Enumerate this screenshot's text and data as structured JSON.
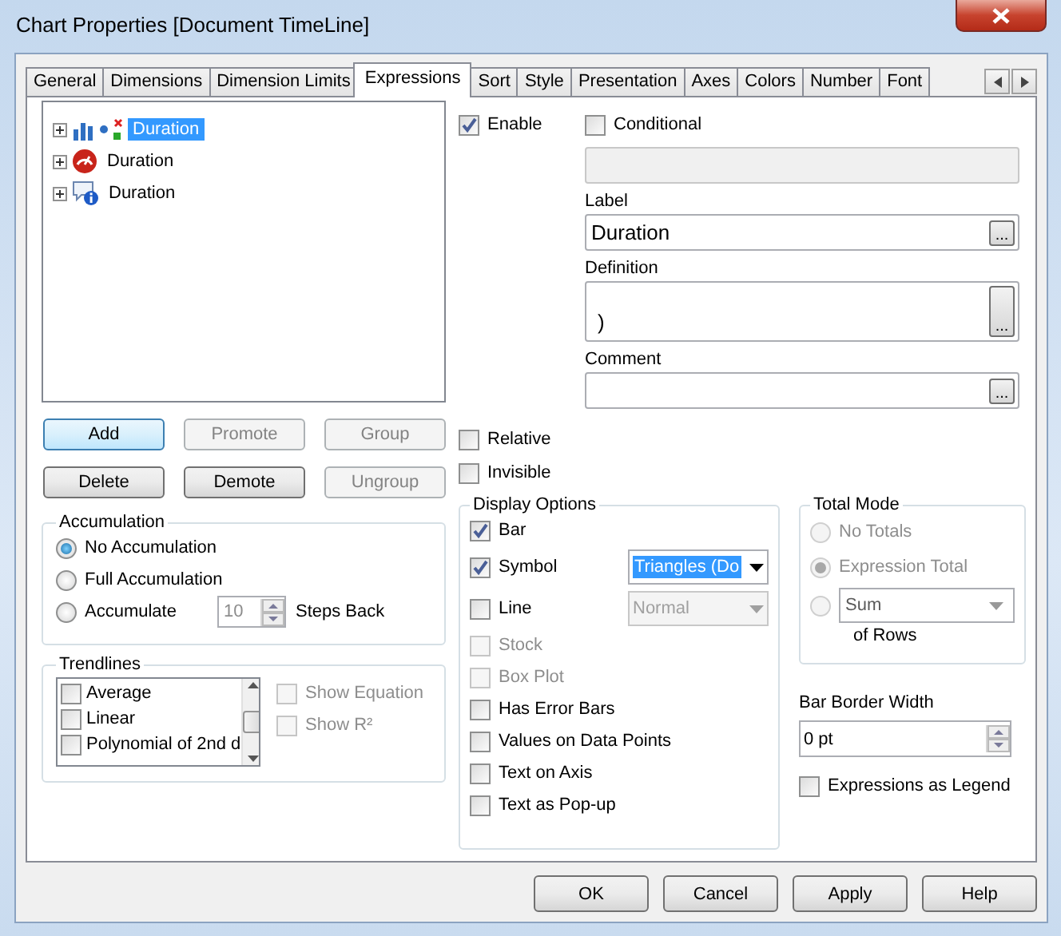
{
  "window": {
    "title": "Chart Properties [Document TimeLine]"
  },
  "tabs": [
    {
      "label": "General",
      "selected": false
    },
    {
      "label": "Dimensions",
      "selected": false
    },
    {
      "label": "Dimension Limits",
      "selected": false
    },
    {
      "label": "Expressions",
      "selected": true
    },
    {
      "label": "Sort",
      "selected": false
    },
    {
      "label": "Style",
      "selected": false
    },
    {
      "label": "Presentation",
      "selected": false
    },
    {
      "label": "Axes",
      "selected": false
    },
    {
      "label": "Colors",
      "selected": false
    },
    {
      "label": "Number",
      "selected": false
    },
    {
      "label": "Font",
      "selected": false
    }
  ],
  "expressions": [
    {
      "label": "Duration",
      "kind": "combo",
      "selected": true,
      "expanded": false
    },
    {
      "label": "Duration",
      "kind": "gauge",
      "selected": false,
      "expanded": false
    },
    {
      "label": "Duration",
      "kind": "info",
      "selected": false,
      "expanded": false
    }
  ],
  "list_buttons": [
    {
      "label": "Add",
      "disabled": false,
      "default": true
    },
    {
      "label": "Promote",
      "disabled": true,
      "default": false
    },
    {
      "label": "Group",
      "disabled": true,
      "default": false
    },
    {
      "label": "Delete",
      "disabled": false,
      "default": false
    },
    {
      "label": "Demote",
      "disabled": false,
      "default": false
    },
    {
      "label": "Ungroup",
      "disabled": true,
      "default": false
    }
  ],
  "accumulation": {
    "title": "Accumulation",
    "options": [
      {
        "label": "No Accumulation",
        "selected": true
      },
      {
        "label": "Full Accumulation",
        "selected": false
      },
      {
        "label": "Accumulate",
        "selected": false
      }
    ],
    "steps": "10",
    "steps_label": "Steps Back"
  },
  "trendlines": {
    "title": "Trendlines",
    "items": [
      {
        "label": "Average",
        "checked": false
      },
      {
        "label": "Linear",
        "checked": false
      },
      {
        "label": "Polynomial of 2nd d",
        "checked": false
      }
    ],
    "options": [
      {
        "label": "Show Equation",
        "checked": false,
        "disabled": true
      },
      {
        "label": "Show R²",
        "checked": false,
        "disabled": true
      }
    ]
  },
  "enable": {
    "label": "Enable",
    "checked": true
  },
  "conditional": {
    "label": "Conditional",
    "checked": false
  },
  "condition_field": {
    "disabled": true
  },
  "fields": [
    {
      "caption": "Label",
      "value": "Duration",
      "button": "...",
      "kind": "single"
    },
    {
      "caption": "Definition",
      "value": ")",
      "button": "...",
      "kind": "multiline"
    },
    {
      "caption": "Comment",
      "button": "...",
      "kind": "single"
    }
  ],
  "flags": [
    {
      "label": "Relative",
      "checked": false
    },
    {
      "label": "Invisible",
      "checked": false
    }
  ],
  "display_options": {
    "title": "Display Options",
    "items": [
      {
        "label": "Bar",
        "checked": true,
        "disabled": false
      },
      {
        "label": "Symbol",
        "checked": true,
        "disabled": false,
        "dropdown": {
          "value": "Triangles (Do",
          "highlighted": true,
          "disabled": false
        }
      },
      {
        "label": "Line",
        "checked": false,
        "disabled": false,
        "dropdown": {
          "value": "Normal",
          "highlighted": false,
          "disabled": true
        }
      },
      {
        "label": "Stock",
        "checked": false,
        "disabled": true
      },
      {
        "label": "Box Plot",
        "checked": false,
        "disabled": true
      },
      {
        "label": "Has Error Bars",
        "checked": false,
        "disabled": false
      },
      {
        "label": "Values on Data Points",
        "checked": false,
        "disabled": false
      },
      {
        "label": "Text on Axis",
        "checked": false,
        "disabled": false
      },
      {
        "label": "Text as Pop-up",
        "checked": false,
        "disabled": false
      }
    ]
  },
  "total_mode": {
    "title": "Total Mode",
    "options": [
      {
        "label": "No Totals",
        "selected": false,
        "disabled": true
      },
      {
        "label": "Expression Total",
        "selected": true,
        "disabled": true
      },
      {
        "dropdown": "Sum",
        "selected": false,
        "disabled": true
      }
    ],
    "suffix": "of Rows"
  },
  "bar_border_width": {
    "caption": "Bar Border Width",
    "value": "0 pt"
  },
  "expressions_as_legend": {
    "label": "Expressions as Legend",
    "checked": false
  },
  "footer_buttons": [
    {
      "label": "OK"
    },
    {
      "label": "Cancel"
    },
    {
      "label": "Apply"
    },
    {
      "label": "Help"
    }
  ]
}
